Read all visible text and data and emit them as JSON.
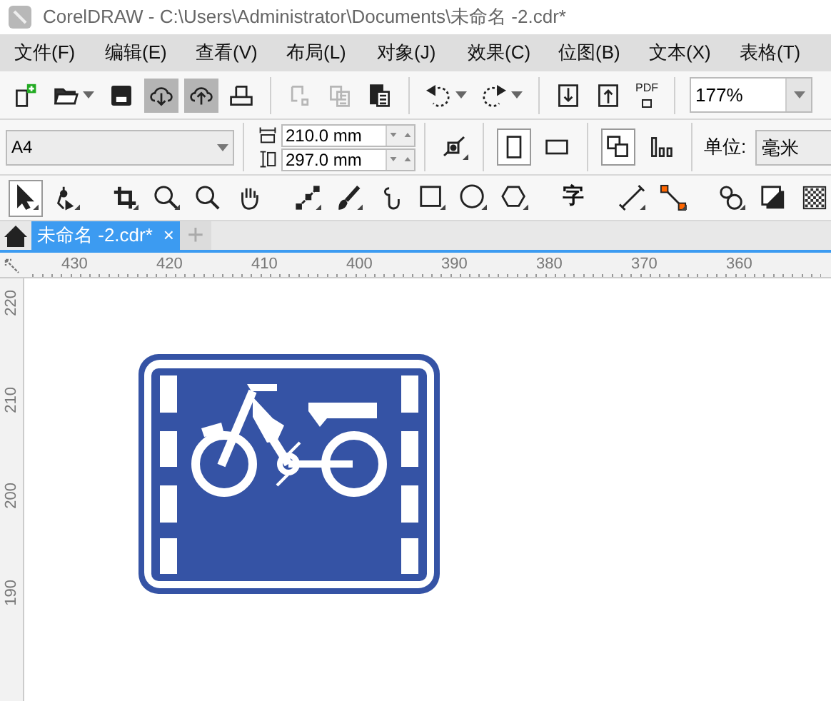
{
  "window": {
    "title": "CorelDRAW - C:\\Users\\Administrator\\Documents\\未命名 -2.cdr*"
  },
  "menu": [
    "文件(F)",
    "编辑(E)",
    "查看(V)",
    "布局(L)",
    "对象(J)",
    "效果(C)",
    "位图(B)",
    "文本(X)",
    "表格(T)"
  ],
  "standard_toolbar": {
    "items": [
      {
        "kind": "new",
        "active": false,
        "disabled": false
      },
      {
        "kind": "open",
        "active": false,
        "disabled": false
      },
      {
        "kind": "save",
        "active": false,
        "disabled": false
      },
      {
        "kind": "cloud-down",
        "active": true,
        "disabled": false
      },
      {
        "kind": "cloud-up",
        "active": true,
        "disabled": false
      },
      {
        "kind": "print",
        "active": false,
        "disabled": false
      },
      {
        "kind": "cut",
        "active": false,
        "disabled": true
      },
      {
        "kind": "copy",
        "active": false,
        "disabled": true
      },
      {
        "kind": "paste",
        "active": false,
        "disabled": false
      },
      {
        "kind": "undo",
        "active": false,
        "disabled": false
      },
      {
        "kind": "redo",
        "active": false,
        "disabled": false
      },
      {
        "kind": "import",
        "active": false,
        "disabled": false
      },
      {
        "kind": "export",
        "active": false,
        "disabled": false
      },
      {
        "kind": "pdf",
        "label": "PDF",
        "active": false,
        "disabled": false
      }
    ],
    "zoom": "177%"
  },
  "property_bar": {
    "page_size": "A4",
    "width": "210.0 mm",
    "height": "297.0 mm",
    "orientation": [
      {
        "kind": "portrait",
        "selected": true
      },
      {
        "kind": "landscape",
        "selected": false
      }
    ],
    "page_layout": [
      {
        "kind": "all-pages",
        "selected": true
      },
      {
        "kind": "current-page",
        "selected": false
      }
    ],
    "unit_label": "单位:",
    "unit": "毫米"
  },
  "toolbox": [
    {
      "kind": "select",
      "selected": true
    },
    {
      "kind": "shape",
      "selected": false
    },
    {
      "kind": "crop",
      "selected": false
    },
    {
      "kind": "zoom",
      "selected": false
    },
    {
      "kind": "zoom2",
      "selected": false
    },
    {
      "kind": "pan",
      "selected": false
    },
    {
      "kind": "line",
      "selected": false
    },
    {
      "kind": "brush",
      "selected": false
    },
    {
      "kind": "curve",
      "selected": false
    },
    {
      "kind": "rect",
      "selected": false
    },
    {
      "kind": "ellipse",
      "selected": false
    },
    {
      "kind": "polygon",
      "selected": false
    },
    {
      "kind": "text",
      "glyph": "字",
      "selected": false
    },
    {
      "kind": "dimension",
      "selected": false
    },
    {
      "kind": "connector",
      "selected": false
    },
    {
      "kind": "blend",
      "selected": false
    },
    {
      "kind": "shadow",
      "selected": false
    },
    {
      "kind": "transparency",
      "selected": false
    }
  ],
  "document_tabs": [
    {
      "label": "未命名 -2.cdr*",
      "close": "×",
      "selected": true
    }
  ],
  "new_tab": "+",
  "rulers": {
    "horizontal": [
      "430",
      "420",
      "410",
      "400",
      "390",
      "380",
      "370",
      "360"
    ],
    "vertical": [
      "220",
      "210",
      "200",
      "190"
    ]
  }
}
